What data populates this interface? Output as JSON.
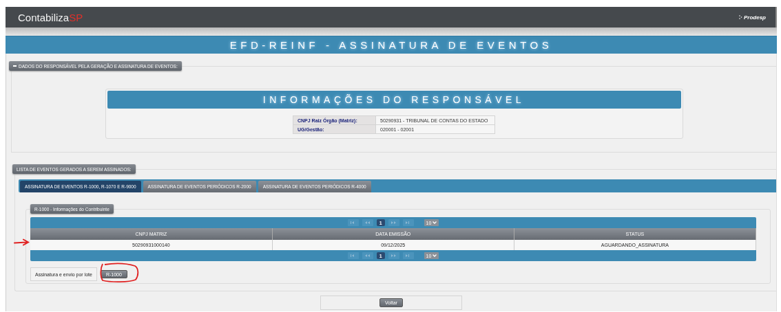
{
  "header": {
    "logo_main": "Contabiliza",
    "logo_accent": "SP",
    "partner": "Prodesp"
  },
  "page_title": "EFD-REINF - ASSINATURA DE EVENTOS",
  "responsible_section": {
    "legend": "DADOS DO RESPONSÁVEL PELA GERAÇÃO E ASSINATURA DE EVENTOS:",
    "expanded": true
  },
  "info": {
    "title": "INFORMAÇÕES DO RESPONSÁVEL",
    "fields": [
      {
        "label": "CNPJ Raiz Órgão (Matriz):",
        "value": "50290931 - TRIBUNAL DE CONTAS DO ESTADO"
      },
      {
        "label": "UG/Gestão:",
        "value": "020001 - 02001"
      }
    ]
  },
  "events_section": {
    "legend": "LISTA DE EVENTOS GERADOS A SEREM ASSINADOS:",
    "tabs": [
      {
        "label": "ASSINATURA DE EVENTOS R-1000, R-1070 E R-9000",
        "selected": true
      },
      {
        "label": "ASSINATURA DE EVENTOS PERIÓDICOS R-2000",
        "selected": false
      },
      {
        "label": "ASSINATURA DE EVENTOS PERIÓDICOS R-4000",
        "selected": false
      }
    ],
    "panel": {
      "legend": "R-1000 - Informações do Contribuinte",
      "pagers": [
        {
          "nav": [
            {
              "kind": "first",
              "disabled": true
            },
            {
              "kind": "prev",
              "disabled": true
            },
            {
              "kind": "next",
              "disabled": true
            },
            {
              "kind": "last",
              "disabled": true
            }
          ],
          "pages": [
            {
              "label": "1",
              "selected": true
            }
          ],
          "page_size": "10"
        },
        {
          "nav": [
            {
              "kind": "first",
              "disabled": true
            },
            {
              "kind": "prev",
              "disabled": true
            },
            {
              "kind": "next",
              "disabled": true
            },
            {
              "kind": "last",
              "disabled": true
            }
          ],
          "pages": [
            {
              "label": "1",
              "selected": true
            }
          ],
          "page_size": "10"
        }
      ],
      "table": {
        "columns": [
          "CNPJ MATRIZ",
          "DATA EMISSÃO",
          "STATUS"
        ],
        "rows": [
          [
            "50290931000140",
            "09/12/2025",
            "AGUARDANDO_ASSINATURA"
          ]
        ]
      },
      "batch": {
        "label": "Assinatura e envio por lote",
        "buttons": [
          "R-1000"
        ]
      }
    }
  },
  "back_button": "Voltar",
  "annotations": [
    {
      "kind": "arrow"
    },
    {
      "kind": "circle"
    }
  ]
}
